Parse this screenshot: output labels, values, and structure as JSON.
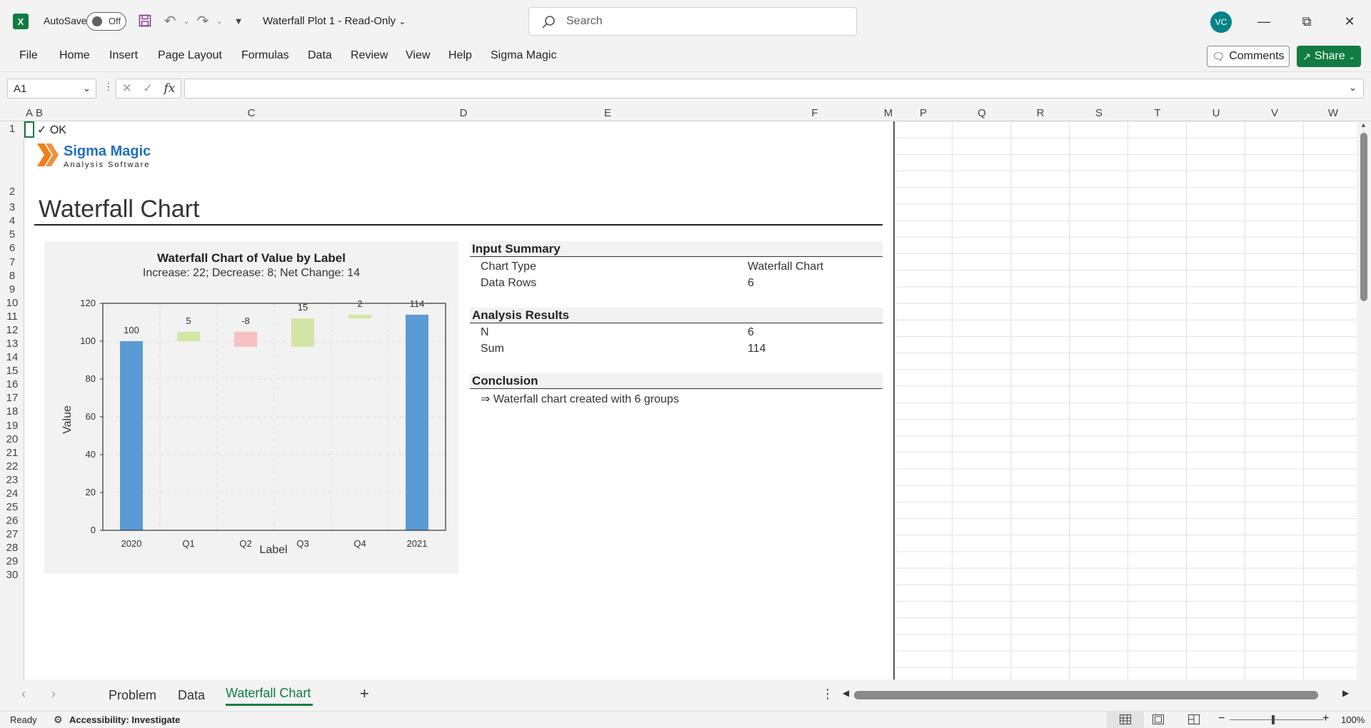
{
  "app": {
    "icon_letter": "X",
    "autosave_label": "AutoSave",
    "autosave_state": "Off",
    "doc_title": "Waterfall Plot 1  -  Read-Only",
    "search_placeholder": "Search",
    "user_initials": "VC"
  },
  "ribbon": {
    "tabs": [
      "File",
      "Home",
      "Insert",
      "Page Layout",
      "Formulas",
      "Data",
      "Review",
      "View",
      "Help",
      "Sigma Magic"
    ],
    "comments_label": "Comments",
    "share_label": "Share"
  },
  "formula_bar": {
    "name_box": "A1",
    "formula": ""
  },
  "grid": {
    "columns": [
      "A",
      "B",
      "C",
      "D",
      "E",
      "F",
      "M",
      "P",
      "Q",
      "R",
      "S",
      "T",
      "U",
      "V",
      "W"
    ],
    "rows": [
      "1",
      "2",
      "3",
      "4",
      "5",
      "6",
      "7",
      "8",
      "9",
      "10",
      "11",
      "12",
      "13",
      "14",
      "15",
      "16",
      "17",
      "18",
      "19",
      "20",
      "21",
      "22",
      "23",
      "24",
      "25",
      "26",
      "27",
      "28",
      "29",
      "30"
    ],
    "cell_b1": "✓ OK",
    "logo_name": "Sigma Magic",
    "logo_sub": "Analysis Software",
    "sheet_title": "Waterfall Chart"
  },
  "summary": {
    "input_header": "Input Summary",
    "input_rows": [
      {
        "label": "Chart Type",
        "value": "Waterfall Chart"
      },
      {
        "label": "Data Rows",
        "value": "6"
      }
    ],
    "results_header": "Analysis Results",
    "results_rows": [
      {
        "label": "N",
        "value": "6"
      },
      {
        "label": "Sum",
        "value": "114"
      }
    ],
    "conclusion_header": "Conclusion",
    "conclusion_text": "⇒ Waterfall chart created with 6 groups"
  },
  "chart_data": {
    "type": "bar",
    "subtype": "waterfall",
    "title": "Waterfall Chart of Value by Label",
    "subtitle": "Increase: 22; Decrease: 8; Net Change: 14",
    "xlabel": "Label",
    "ylabel": "Value",
    "ylim": [
      0,
      120
    ],
    "yticks": [
      0,
      20,
      40,
      60,
      80,
      100,
      120
    ],
    "categories": [
      "2020",
      "Q1",
      "Q2",
      "Q3",
      "Q4",
      "2021"
    ],
    "values": [
      100,
      5,
      -8,
      15,
      2,
      114
    ],
    "kinds": [
      "total",
      "increase",
      "decrease",
      "increase",
      "increase",
      "total"
    ],
    "data_labels": [
      "100",
      "5",
      "-8",
      "15",
      "2",
      "114"
    ],
    "colors": {
      "total": "#5b9bd5",
      "increase": "#d2e6a5",
      "decrease": "#f6c1c1"
    },
    "grid": true
  },
  "sheet_tabs": [
    "Problem",
    "Data",
    "Waterfall Chart"
  ],
  "active_tab": "Waterfall Chart",
  "status": {
    "ready": "Ready",
    "accessibility": "Accessibility: Investigate",
    "zoom": "100%"
  }
}
